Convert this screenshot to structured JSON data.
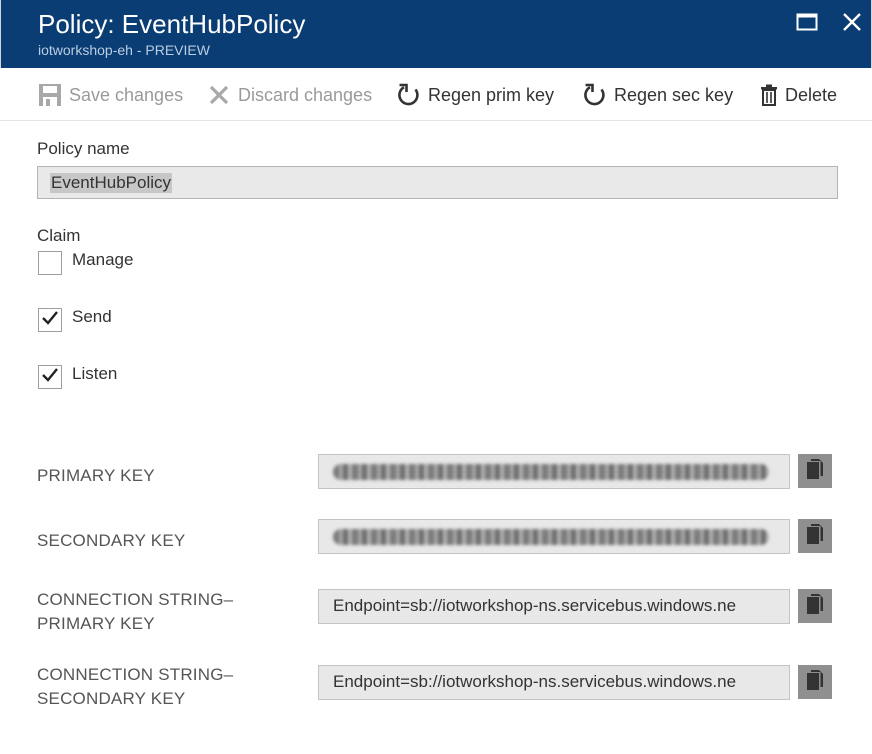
{
  "header": {
    "title": "Policy: EventHubPolicy",
    "subtitle": "iotworkshop-eh - PREVIEW",
    "icons": [
      "maximize-icon",
      "close-icon"
    ]
  },
  "toolbar": {
    "save_label": "Save changes",
    "discard_label": "Discard changes",
    "regen_prim_label": "Regen prim key",
    "regen_sec_label": "Regen sec key",
    "delete_label": "Delete"
  },
  "form": {
    "policy_name_label": "Policy name",
    "policy_name_value": "EventHubPolicy",
    "claim_label": "Claim",
    "claims": [
      {
        "label": "Manage",
        "checked": false
      },
      {
        "label": "Send",
        "checked": true
      },
      {
        "label": "Listen",
        "checked": true
      }
    ]
  },
  "keys": {
    "primary_key_label": "PRIMARY KEY",
    "secondary_key_label": "SECONDARY KEY",
    "conn_primary_label_line1": "CONNECTION STRING–",
    "conn_primary_label_line2": "PRIMARY KEY",
    "conn_secondary_label_line1": "CONNECTION STRING–",
    "conn_secondary_label_line2": "SECONDARY KEY",
    "conn_primary_value": "Endpoint=sb://iotworkshop-ns.servicebus.windows.ne",
    "conn_secondary_value": "Endpoint=sb://iotworkshop-ns.servicebus.windows.ne"
  },
  "colors": {
    "header_bg": "#0a3d73",
    "copy_button_bg": "#8f8f8f",
    "disabled_text": "#9a9a9a"
  }
}
